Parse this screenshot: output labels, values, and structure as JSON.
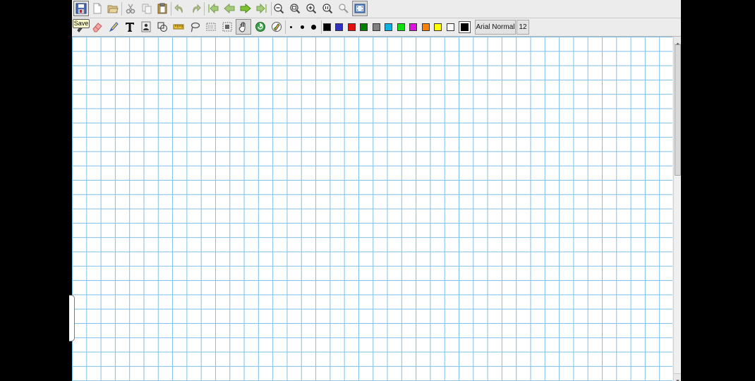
{
  "toolbar_main": {
    "buttons": [
      "save-icon",
      "new-file-icon",
      "open-folder-icon",
      "cut-icon",
      "copy-icon",
      "paste-icon",
      "undo-icon",
      "redo-icon",
      "first-page-icon",
      "previous-page-icon",
      "next-page-icon",
      "last-page-icon",
      "zoom-out-icon",
      "zoom-fit-icon",
      "zoom-in-icon",
      "zoom-actual-icon",
      "zoom-tool-icon",
      "fullscreen-icon"
    ]
  },
  "toolbar_tools": {
    "tools": [
      "pen-icon",
      "eraser-icon",
      "highlighter-icon",
      "text-icon",
      "image-icon",
      "shapes-icon",
      "ruler-icon",
      "lasso-icon",
      "select-rect-icon",
      "select-region-icon",
      "hand-icon",
      "refresh-icon",
      "recognize-pen-icon"
    ],
    "pen_sizes": [
      "small",
      "medium",
      "large"
    ],
    "colors": [
      "#000000",
      "#3030c0",
      "#e01010",
      "#008000",
      "#808080",
      "#10b0e0",
      "#10e010",
      "#e010e0",
      "#ff8000",
      "#ffff00",
      "#ffffff",
      "#000000"
    ],
    "selected_color": "#000000",
    "font_label": "Arial Normal",
    "font_size": "12"
  },
  "tooltip": {
    "text": "Save"
  },
  "canvas": {
    "background": "graph paper",
    "grid_color": "#7fbfe8"
  }
}
